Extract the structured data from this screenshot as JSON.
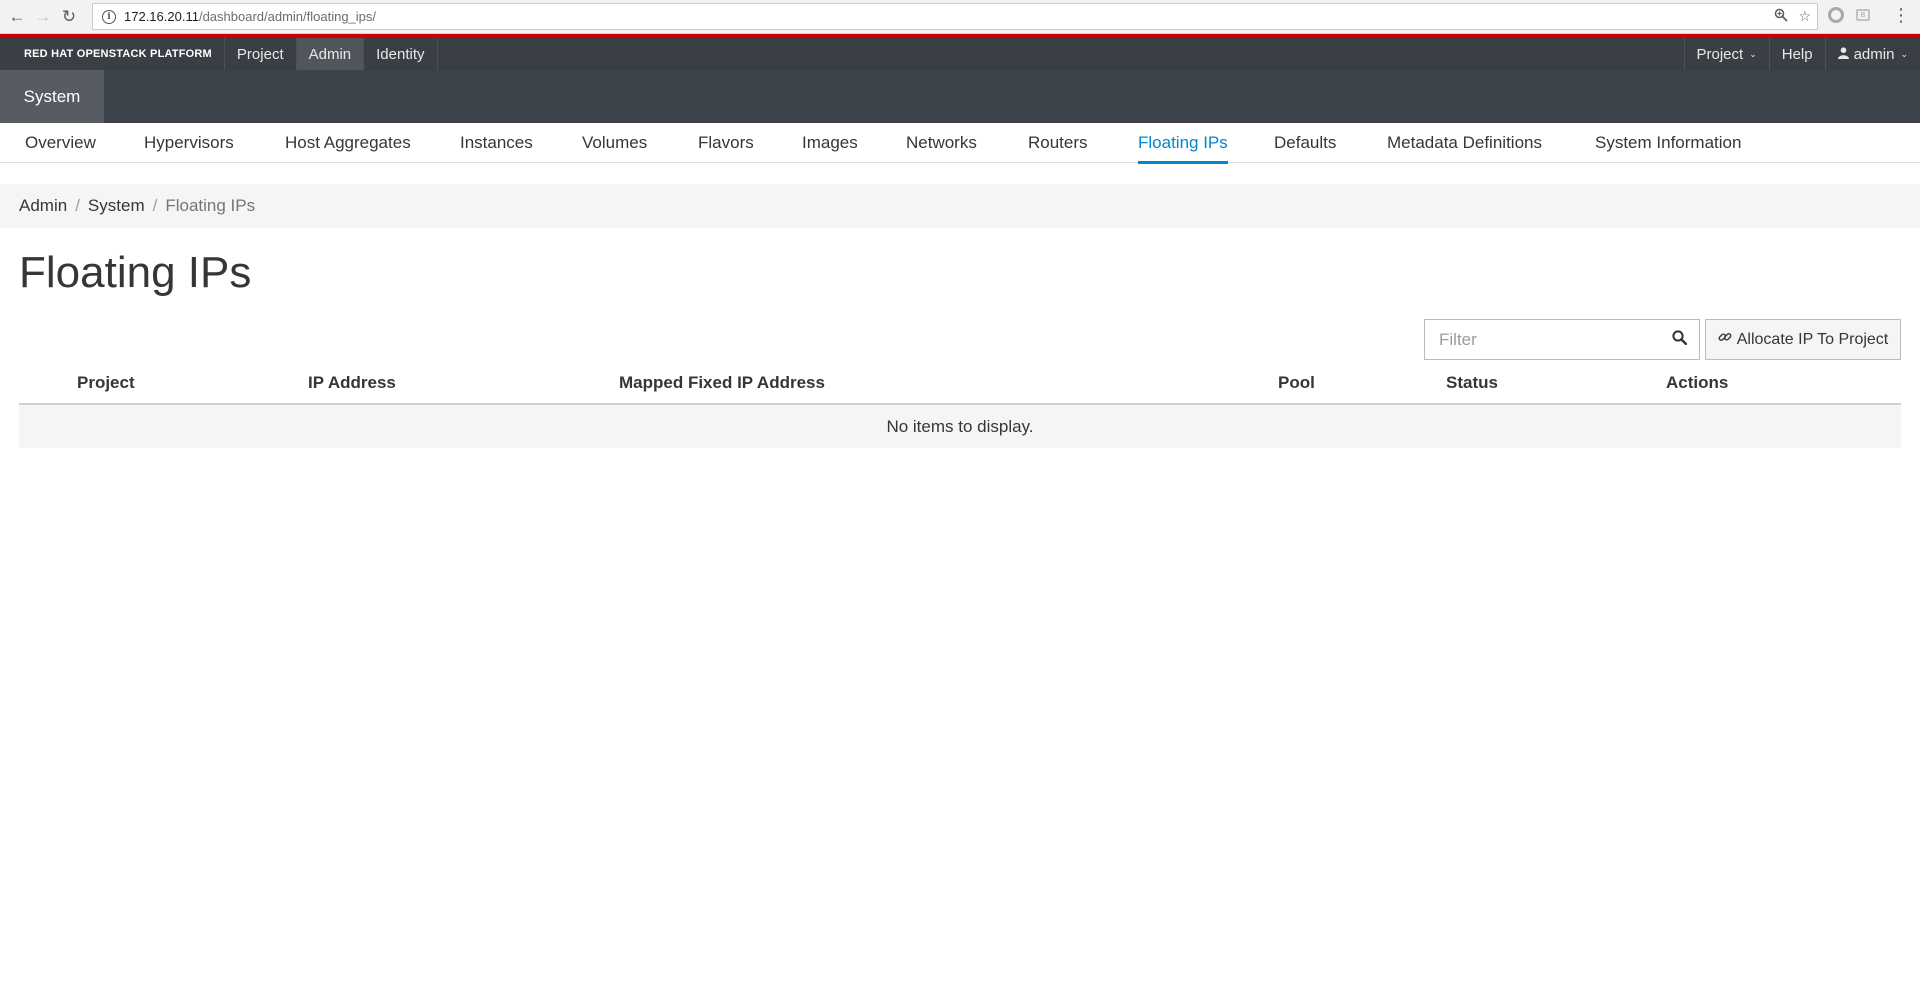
{
  "browser": {
    "url_host": "172.16.20.11",
    "url_path": "/dashboard/admin/floating_ips/"
  },
  "masthead": {
    "brand": "RED HAT OPENSTACK PLATFORM",
    "nav": [
      "Project",
      "Admin",
      "Identity"
    ],
    "right": {
      "project_menu": "Project",
      "help": "Help",
      "user": "admin"
    }
  },
  "secondary": {
    "active_tab": "System"
  },
  "tertiary_nav": {
    "items": [
      "Overview",
      "Hypervisors",
      "Host Aggregates",
      "Instances",
      "Volumes",
      "Flavors",
      "Images",
      "Networks",
      "Routers",
      "Floating IPs",
      "Defaults",
      "Metadata Definitions",
      "System Information"
    ],
    "active": "Floating IPs"
  },
  "breadcrumb": [
    "Admin",
    "System",
    "Floating IPs"
  ],
  "page": {
    "title": "Floating IPs"
  },
  "toolbar": {
    "filter_placeholder": "Filter",
    "allocate_label": "Allocate IP To Project"
  },
  "table": {
    "columns": [
      "Project",
      "IP Address",
      "Mapped Fixed IP Address",
      "Pool",
      "Status",
      "Actions"
    ],
    "empty_message": "No items to display."
  },
  "colors": {
    "accent_red": "#cc0000",
    "active_link": "#0088ce",
    "masthead_bg": "#393f44"
  }
}
